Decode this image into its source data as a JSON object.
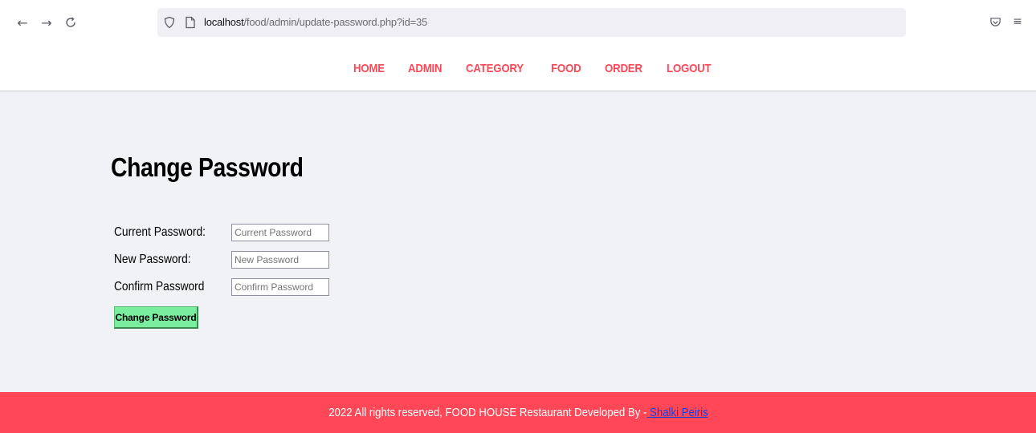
{
  "browser": {
    "back_glyph": "←",
    "forward_glyph": "→",
    "reload_glyph": "C",
    "url_host": "localhost",
    "url_path": "/food/admin/update-password.php?id=35",
    "star_glyph": "☆",
    "pocket_glyph": "⊽",
    "menu_glyph": "≡",
    "icons": [
      "back-arrow-icon",
      "forward-arrow-icon",
      "reload-icon",
      "shield-icon",
      "page-icon",
      "bookmark-star-icon",
      "pocket-icon",
      "hamburger-menu-icon"
    ]
  },
  "menu": {
    "items": [
      "HOME",
      "ADMIN",
      "CATEGORY",
      "FOOD",
      "ORDER",
      "LOGOUT"
    ],
    "color": "#ff4757"
  },
  "main": {
    "title": "Change Password",
    "fields": [
      {
        "label": "Current Password:",
        "placeholder": "Current Password",
        "value": ""
      },
      {
        "label": "New Password:",
        "placeholder": "New Password",
        "value": ""
      },
      {
        "label": "Confirm Password",
        "placeholder": "Confirm Password",
        "value": ""
      }
    ],
    "submit_label": "Change Password",
    "background": "#f1f2f6",
    "button_color": "#7bed9f"
  },
  "footer": {
    "text": "2022 All rights reserved, FOOD HOUSE Restaurant Developed By -",
    "link_text": " Shalki Peiris",
    "background": "#ff4757"
  }
}
